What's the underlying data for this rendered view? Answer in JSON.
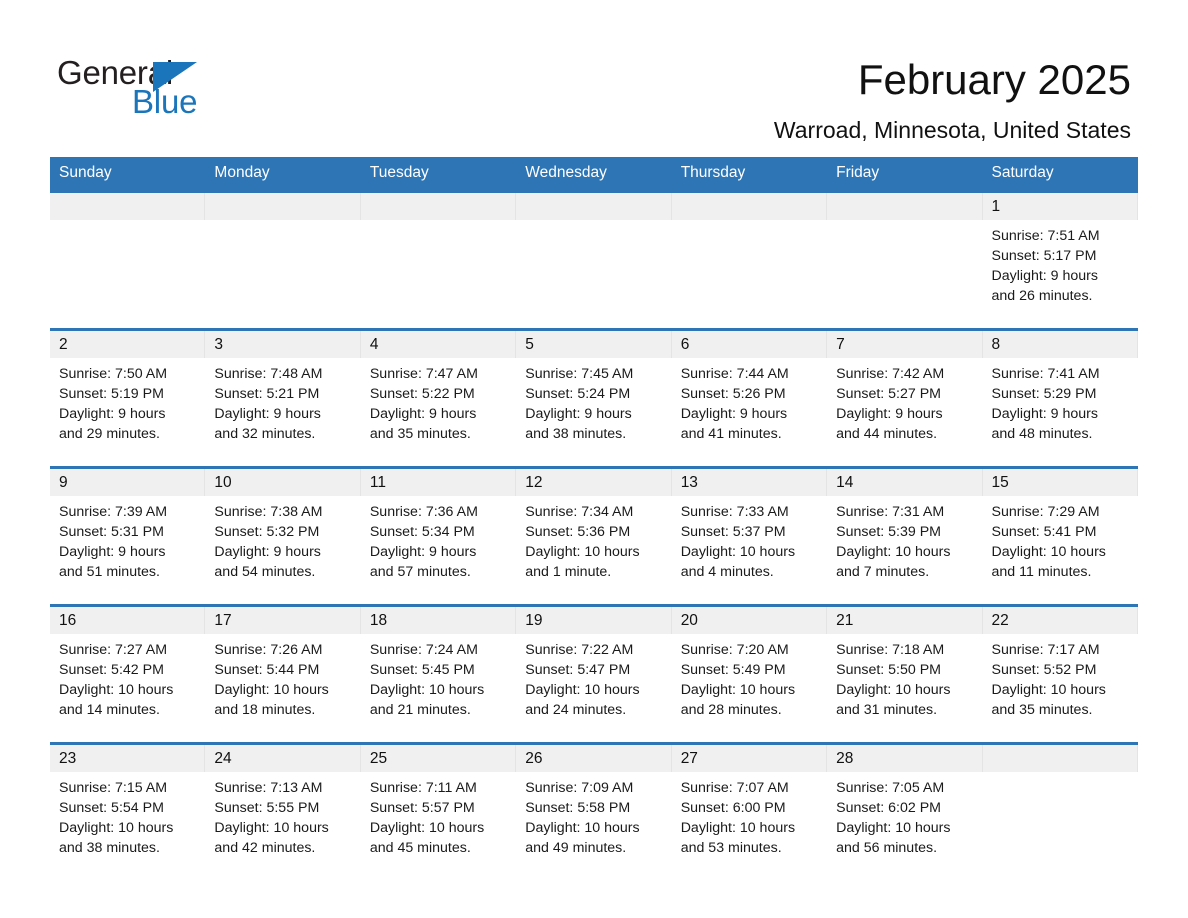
{
  "brand": {
    "name_part1": "General",
    "name_part2": "Blue",
    "accent_color": "#1b75bb"
  },
  "header": {
    "title": "February 2025",
    "subtitle": "Warroad, Minnesota, United States",
    "header_bg_color": "#2e75b6",
    "daynum_bg_color": "#f0f0f0"
  },
  "weekday_headers": [
    "Sunday",
    "Monday",
    "Tuesday",
    "Wednesday",
    "Thursday",
    "Friday",
    "Saturday"
  ],
  "weeks": [
    [
      {
        "day": "",
        "sunrise": "",
        "sunset": "",
        "daylight_line1": "",
        "daylight_line2": ""
      },
      {
        "day": "",
        "sunrise": "",
        "sunset": "",
        "daylight_line1": "",
        "daylight_line2": ""
      },
      {
        "day": "",
        "sunrise": "",
        "sunset": "",
        "daylight_line1": "",
        "daylight_line2": ""
      },
      {
        "day": "",
        "sunrise": "",
        "sunset": "",
        "daylight_line1": "",
        "daylight_line2": ""
      },
      {
        "day": "",
        "sunrise": "",
        "sunset": "",
        "daylight_line1": "",
        "daylight_line2": ""
      },
      {
        "day": "",
        "sunrise": "",
        "sunset": "",
        "daylight_line1": "",
        "daylight_line2": ""
      },
      {
        "day": "1",
        "sunrise": "Sunrise: 7:51 AM",
        "sunset": "Sunset: 5:17 PM",
        "daylight_line1": "Daylight: 9 hours",
        "daylight_line2": "and 26 minutes."
      }
    ],
    [
      {
        "day": "2",
        "sunrise": "Sunrise: 7:50 AM",
        "sunset": "Sunset: 5:19 PM",
        "daylight_line1": "Daylight: 9 hours",
        "daylight_line2": "and 29 minutes."
      },
      {
        "day": "3",
        "sunrise": "Sunrise: 7:48 AM",
        "sunset": "Sunset: 5:21 PM",
        "daylight_line1": "Daylight: 9 hours",
        "daylight_line2": "and 32 minutes."
      },
      {
        "day": "4",
        "sunrise": "Sunrise: 7:47 AM",
        "sunset": "Sunset: 5:22 PM",
        "daylight_line1": "Daylight: 9 hours",
        "daylight_line2": "and 35 minutes."
      },
      {
        "day": "5",
        "sunrise": "Sunrise: 7:45 AM",
        "sunset": "Sunset: 5:24 PM",
        "daylight_line1": "Daylight: 9 hours",
        "daylight_line2": "and 38 minutes."
      },
      {
        "day": "6",
        "sunrise": "Sunrise: 7:44 AM",
        "sunset": "Sunset: 5:26 PM",
        "daylight_line1": "Daylight: 9 hours",
        "daylight_line2": "and 41 minutes."
      },
      {
        "day": "7",
        "sunrise": "Sunrise: 7:42 AM",
        "sunset": "Sunset: 5:27 PM",
        "daylight_line1": "Daylight: 9 hours",
        "daylight_line2": "and 44 minutes."
      },
      {
        "day": "8",
        "sunrise": "Sunrise: 7:41 AM",
        "sunset": "Sunset: 5:29 PM",
        "daylight_line1": "Daylight: 9 hours",
        "daylight_line2": "and 48 minutes."
      }
    ],
    [
      {
        "day": "9",
        "sunrise": "Sunrise: 7:39 AM",
        "sunset": "Sunset: 5:31 PM",
        "daylight_line1": "Daylight: 9 hours",
        "daylight_line2": "and 51 minutes."
      },
      {
        "day": "10",
        "sunrise": "Sunrise: 7:38 AM",
        "sunset": "Sunset: 5:32 PM",
        "daylight_line1": "Daylight: 9 hours",
        "daylight_line2": "and 54 minutes."
      },
      {
        "day": "11",
        "sunrise": "Sunrise: 7:36 AM",
        "sunset": "Sunset: 5:34 PM",
        "daylight_line1": "Daylight: 9 hours",
        "daylight_line2": "and 57 minutes."
      },
      {
        "day": "12",
        "sunrise": "Sunrise: 7:34 AM",
        "sunset": "Sunset: 5:36 PM",
        "daylight_line1": "Daylight: 10 hours",
        "daylight_line2": "and 1 minute."
      },
      {
        "day": "13",
        "sunrise": "Sunrise: 7:33 AM",
        "sunset": "Sunset: 5:37 PM",
        "daylight_line1": "Daylight: 10 hours",
        "daylight_line2": "and 4 minutes."
      },
      {
        "day": "14",
        "sunrise": "Sunrise: 7:31 AM",
        "sunset": "Sunset: 5:39 PM",
        "daylight_line1": "Daylight: 10 hours",
        "daylight_line2": "and 7 minutes."
      },
      {
        "day": "15",
        "sunrise": "Sunrise: 7:29 AM",
        "sunset": "Sunset: 5:41 PM",
        "daylight_line1": "Daylight: 10 hours",
        "daylight_line2": "and 11 minutes."
      }
    ],
    [
      {
        "day": "16",
        "sunrise": "Sunrise: 7:27 AM",
        "sunset": "Sunset: 5:42 PM",
        "daylight_line1": "Daylight: 10 hours",
        "daylight_line2": "and 14 minutes."
      },
      {
        "day": "17",
        "sunrise": "Sunrise: 7:26 AM",
        "sunset": "Sunset: 5:44 PM",
        "daylight_line1": "Daylight: 10 hours",
        "daylight_line2": "and 18 minutes."
      },
      {
        "day": "18",
        "sunrise": "Sunrise: 7:24 AM",
        "sunset": "Sunset: 5:45 PM",
        "daylight_line1": "Daylight: 10 hours",
        "daylight_line2": "and 21 minutes."
      },
      {
        "day": "19",
        "sunrise": "Sunrise: 7:22 AM",
        "sunset": "Sunset: 5:47 PM",
        "daylight_line1": "Daylight: 10 hours",
        "daylight_line2": "and 24 minutes."
      },
      {
        "day": "20",
        "sunrise": "Sunrise: 7:20 AM",
        "sunset": "Sunset: 5:49 PM",
        "daylight_line1": "Daylight: 10 hours",
        "daylight_line2": "and 28 minutes."
      },
      {
        "day": "21",
        "sunrise": "Sunrise: 7:18 AM",
        "sunset": "Sunset: 5:50 PM",
        "daylight_line1": "Daylight: 10 hours",
        "daylight_line2": "and 31 minutes."
      },
      {
        "day": "22",
        "sunrise": "Sunrise: 7:17 AM",
        "sunset": "Sunset: 5:52 PM",
        "daylight_line1": "Daylight: 10 hours",
        "daylight_line2": "and 35 minutes."
      }
    ],
    [
      {
        "day": "23",
        "sunrise": "Sunrise: 7:15 AM",
        "sunset": "Sunset: 5:54 PM",
        "daylight_line1": "Daylight: 10 hours",
        "daylight_line2": "and 38 minutes."
      },
      {
        "day": "24",
        "sunrise": "Sunrise: 7:13 AM",
        "sunset": "Sunset: 5:55 PM",
        "daylight_line1": "Daylight: 10 hours",
        "daylight_line2": "and 42 minutes."
      },
      {
        "day": "25",
        "sunrise": "Sunrise: 7:11 AM",
        "sunset": "Sunset: 5:57 PM",
        "daylight_line1": "Daylight: 10 hours",
        "daylight_line2": "and 45 minutes."
      },
      {
        "day": "26",
        "sunrise": "Sunrise: 7:09 AM",
        "sunset": "Sunset: 5:58 PM",
        "daylight_line1": "Daylight: 10 hours",
        "daylight_line2": "and 49 minutes."
      },
      {
        "day": "27",
        "sunrise": "Sunrise: 7:07 AM",
        "sunset": "Sunset: 6:00 PM",
        "daylight_line1": "Daylight: 10 hours",
        "daylight_line2": "and 53 minutes."
      },
      {
        "day": "28",
        "sunrise": "Sunrise: 7:05 AM",
        "sunset": "Sunset: 6:02 PM",
        "daylight_line1": "Daylight: 10 hours",
        "daylight_line2": "and 56 minutes."
      },
      {
        "day": "",
        "sunrise": "",
        "sunset": "",
        "daylight_line1": "",
        "daylight_line2": ""
      }
    ]
  ]
}
